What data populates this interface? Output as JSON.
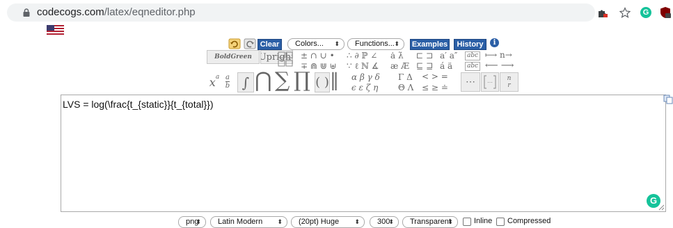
{
  "browser": {
    "url_host": "codecogs.com",
    "url_path": "/latex/eqneditor.php",
    "extension_icons": [
      "puzzle-extension-icon",
      "bookmark-star-icon",
      "grammarly-icon",
      "ublock-icon"
    ]
  },
  "toolbar": {
    "clear_label": "Clear",
    "colors_label": "Colors...",
    "functions_label": "Functions...",
    "examples_label": "Examples",
    "history_label": "History",
    "info_label": "i",
    "bold_label": "BoldGreen",
    "upright_label": "Upright"
  },
  "symbols": {
    "ops_row1": "± ∩ ∪ •",
    "ops_row2": "∓ ⋒ ⋓ ⊎",
    "greek_row1": "∴ ∂ ℙ ∠",
    "greek_row2": "∵ ℓ ℕ ∡",
    "acc_row1": "ȧ λ̇",
    "acc_row2": "æ Æ",
    "sets_row1": "⊏ ⊐",
    "sets_row2": "⊑ ⊒",
    "pow_row1": "a′ a″",
    "pow_row2": "á ä",
    "arrow_row1": "⟼ n→",
    "arrow_row2": "⟵ ⟶",
    "abc": "abc",
    "greek_letters_row1": "α β γ δ",
    "greek_letters_row2": "ϵ ε ζ η",
    "cap_greek_row1": "Γ Δ",
    "cap_greek_row2": "Θ Λ",
    "rel_row1": "< > =",
    "rel_row2": "≤ ≥ ≐",
    "big_sum": "∑",
    "big_prod": "∏",
    "big_cap": "⋂",
    "big_int": "∫",
    "parens": "( )",
    "norm": "‖",
    "dots": "⋯",
    "binom_n": "n",
    "binom_r": "r",
    "xa_base": "x",
    "xa_exp": "a",
    "frac_num": "a",
    "frac_den": "b"
  },
  "editor": {
    "content": "LVS = log(\\frac{t_{static}}{t_{total}})"
  },
  "footer": {
    "format_value": "png",
    "font_value": "Latin Modern",
    "size_value": "(20pt) Huge",
    "dpi_value": "300",
    "background_value": "Transparent",
    "inline_label": "Inline",
    "compressed_label": "Compressed"
  },
  "colors": {
    "accent_blue": "#2b5fa6",
    "grammarly_green": "#15c39a"
  }
}
